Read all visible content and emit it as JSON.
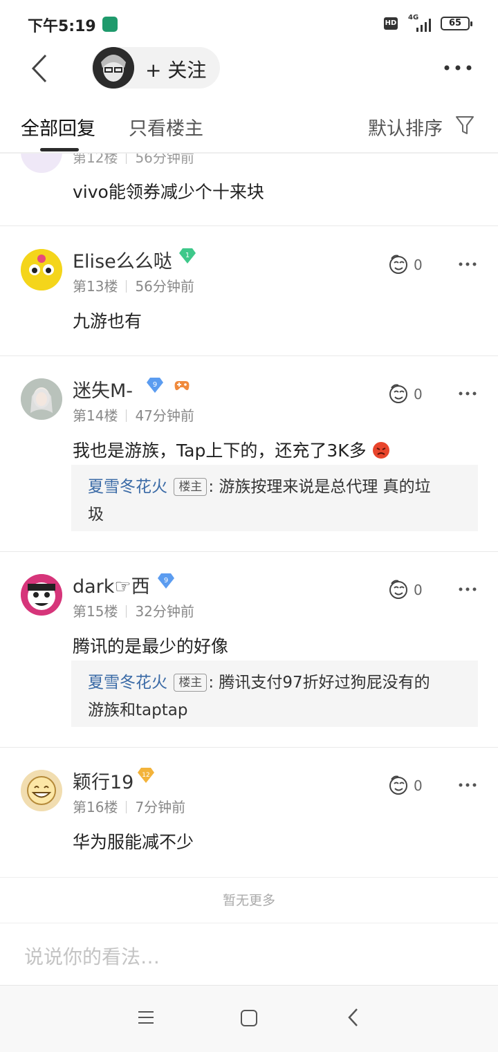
{
  "status_bar": {
    "time": "下午5:19",
    "hd": "HD",
    "network": "4G",
    "battery": "65"
  },
  "header": {
    "follow_label": "+ 关注"
  },
  "tabs": {
    "all_replies": "全部回复",
    "owner_only": "只看楼主",
    "sort": "默认排序"
  },
  "partial_post": {
    "floor": "第12楼",
    "time": "56分钟前",
    "content": "vivo能领券减少个十来块"
  },
  "posts": [
    {
      "username": "Elise么么哒",
      "badge_level": "1",
      "floor": "第13楼",
      "time": "56分钟前",
      "content": "九游也有",
      "likes": "0"
    },
    {
      "username": "迷失M-",
      "badge_level": "9",
      "floor": "第14楼",
      "time": "47分钟前",
      "content": "我也是游族，Tap上下的，还充了3K多",
      "likes": "0",
      "quote": {
        "name": "夏雪冬花火",
        "owner_tag": "楼主",
        "line1": ": 游族按理来说是总代理 真的垃",
        "line2": "圾"
      }
    },
    {
      "username": "dark☞西",
      "badge_level": "9",
      "floor": "第15楼",
      "time": "32分钟前",
      "content": "腾讯的是最少的好像",
      "likes": "0",
      "quote": {
        "name": "夏雪冬花火",
        "owner_tag": "楼主",
        "line1": ": 腾讯支付97折好过狗屁没有的",
        "line2": "游族和taptap"
      }
    },
    {
      "username": "颖行19",
      "badge_level": "12",
      "floor": "第16楼",
      "time": "7分钟前",
      "content": "华为服能减不少",
      "likes": "0"
    }
  ],
  "footer": {
    "no_more": "暂无更多",
    "comment_placeholder": "说说你的看法…"
  },
  "colors": {
    "quote_name": "#3a6aa6",
    "badge_blue": "#5b9cf0",
    "badge_green": "#3ec88a",
    "badge_gold": "#f3b33a"
  }
}
